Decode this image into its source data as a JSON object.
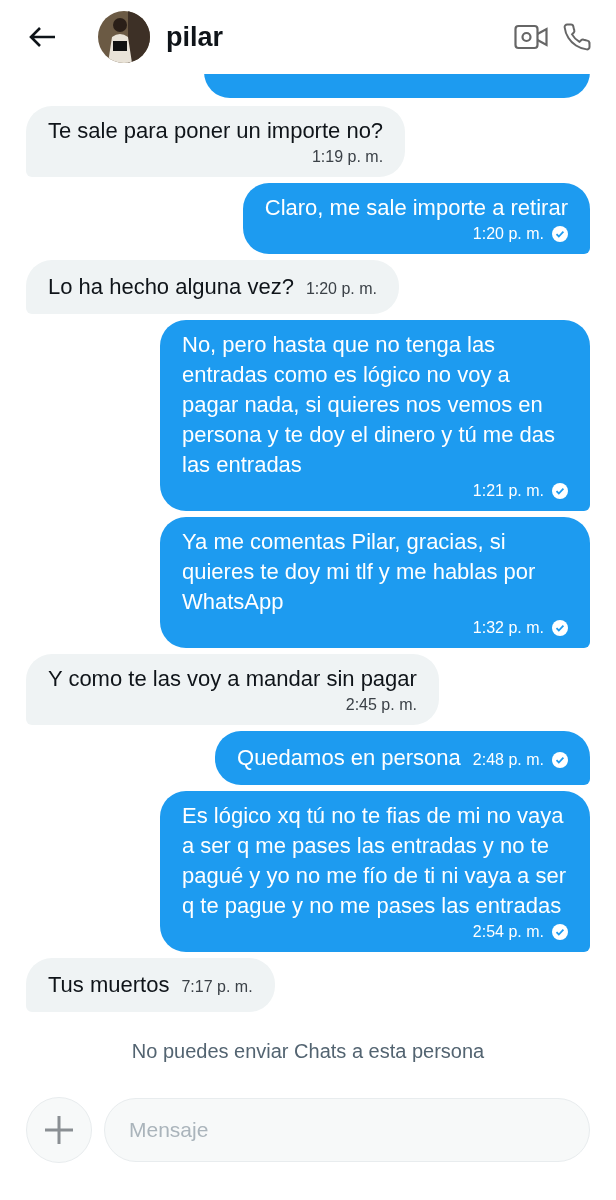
{
  "header": {
    "name": "pilar"
  },
  "messages": [
    {
      "kind": "clipped",
      "outgoing": true
    },
    {
      "kind": "text",
      "outgoing": false,
      "text": "Te sale para poner un importe no?",
      "time": "1:19 p. m.",
      "inline": false
    },
    {
      "kind": "text",
      "outgoing": true,
      "text": "Claro, me sale importe a retirar",
      "time": "1:20 p. m.",
      "inline": false,
      "read": true
    },
    {
      "kind": "text",
      "outgoing": false,
      "text": "Lo ha hecho alguna vez?",
      "time": "1:20 p. m.",
      "inline": true
    },
    {
      "kind": "text",
      "outgoing": true,
      "text": "No, pero hasta que no tenga las entradas como es lógico no voy a pagar nada, si quieres nos vemos en persona y te doy el dinero y tú me das las entradas",
      "time": "1:21 p. m.",
      "inline": false,
      "read": true
    },
    {
      "kind": "text",
      "outgoing": true,
      "text": "Ya me comentas Pilar, gracias, si quieres te doy mi tlf y me hablas por WhatsApp",
      "time": "1:32 p. m.",
      "inline": false,
      "read": true
    },
    {
      "kind": "text",
      "outgoing": false,
      "text": "Y como te las voy a mandar sin pagar",
      "time": "2:45 p. m.",
      "inline": false
    },
    {
      "kind": "text",
      "outgoing": true,
      "text": "Quedamos en persona",
      "time": "2:48 p. m.",
      "inline": true,
      "read": true
    },
    {
      "kind": "text",
      "outgoing": true,
      "text": "Es lógico xq tú no te fias de mi no vaya a ser q me pases las entradas y no te pagué y yo no me fío de ti ni vaya a ser q te pague y no me pases las entradas",
      "time": "2:54 p. m.",
      "inline": false,
      "read": true
    },
    {
      "kind": "text",
      "outgoing": false,
      "text": "Tus muertos",
      "time": "7:17 p. m.",
      "inline": true
    }
  ],
  "notice": "No puedes enviar Chats a esta persona",
  "composer": {
    "placeholder": "Mensaje"
  }
}
